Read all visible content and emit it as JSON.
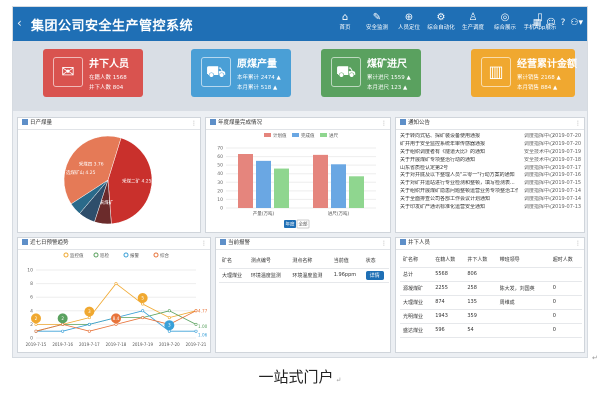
{
  "app": {
    "title": "集团公司安全生产管控系统",
    "back_icon": "chevron-left-icon"
  },
  "nav": [
    {
      "label": "首页",
      "icon": "home-icon",
      "glyph": "⌂"
    },
    {
      "label": "安全监测",
      "icon": "monitor-icon",
      "glyph": "✎"
    },
    {
      "label": "人员定位",
      "icon": "location-icon",
      "glyph": "⊕"
    },
    {
      "label": "综合自动化",
      "icon": "automation-icon",
      "glyph": "⚙"
    },
    {
      "label": "生产调度",
      "icon": "dispatch-icon",
      "glyph": "♙"
    },
    {
      "label": "综合展示",
      "icon": "display-icon",
      "glyph": "◎"
    },
    {
      "label": "手机App展示",
      "icon": "phone-icon",
      "glyph": "▯"
    }
  ],
  "topright": {
    "grid_glyph": "▦",
    "user_glyph": "☺",
    "help_glyph": "?",
    "account_glyph": "⚇▾"
  },
  "cards": [
    {
      "title": "井下人员",
      "line1": "在籍人数 1568",
      "line2": "井下人数 804",
      "color": "#d9534f",
      "glyph": "✉"
    },
    {
      "title": "原煤产量",
      "line1": "本年累计 2474 ▲",
      "line2": "本月累计 518 ▲",
      "color": "#4a9fd6",
      "glyph": "⛟"
    },
    {
      "title": "煤矿进尺",
      "line1": "累计进尺 1559 ▲",
      "line2": "本月进尺 123 ▲",
      "color": "#5aa15f",
      "glyph": "⛟"
    },
    {
      "title": "经营累计金额",
      "line1": "累计销售 2168 ▲",
      "line2": "本月销售 884 ▲",
      "color": "#f0a830",
      "glyph": "▥"
    }
  ],
  "panels": {
    "pie": {
      "title": "日产煤量"
    },
    "bar": {
      "title": "年度煤量完成情况"
    },
    "notice": {
      "title": "通知公告"
    },
    "line": {
      "title": "近七日预警趋势"
    },
    "alarm": {
      "title": "当前报警"
    },
    "people": {
      "title": "井下人员"
    }
  },
  "pie_chart": {
    "slices": [
      {
        "label": "采煤二矿 4.25",
        "value": 4.25,
        "color": "#c9302c"
      },
      {
        "label": "综采煤矿",
        "value": 0.6,
        "color": "#6b2b2b"
      },
      {
        "label": "",
        "value": 0.6,
        "color": "#2e4e6b"
      },
      {
        "label": "",
        "value": 0.45,
        "color": "#2a6a8a"
      },
      {
        "label": "采煤四 3.76",
        "value": 3.76,
        "color": "#e57a57"
      }
    ],
    "left_label": "选煤矿山 4.25"
  },
  "bar_chart": {
    "legend": [
      "计划值",
      "完成值",
      "进尺"
    ],
    "colors": [
      "#e5857d",
      "#6aa7e3",
      "#8fd68f"
    ],
    "categories": [
      "产量(万吨)",
      "进尺(万吨)"
    ],
    "series": [
      [
        63,
        62
      ],
      [
        55,
        51
      ],
      [
        46,
        37
      ]
    ],
    "yticks": [
      "70",
      "60",
      "50",
      "40",
      "30",
      "20",
      "10",
      "0"
    ],
    "ymax": 70,
    "btn_year": "年度",
    "btn_all": "全部"
  },
  "notices": [
    {
      "t": "关于转向式钻、探矿装设备使用通报",
      "s": "调度指挥中心",
      "d": "2019-07-20"
    },
    {
      "t": "矿井用于安全监控系统年审传感器通报",
      "s": "调度指挥中心",
      "d": "2019-07-20"
    },
    {
      "t": "关于组织调度者有《隧道大比》的通知",
      "s": "安全技术中心",
      "d": "2019-07-19"
    },
    {
      "t": "关于开展煤矿专项整治行动的通知",
      "s": "安全技术中心",
      "d": "2019-07-18"
    },
    {
      "t": "山东省质检认定第2号",
      "s": "调度指挥中心",
      "d": "2019-07-17"
    },
    {
      "t": "关于对井底及以下整理人员\"三零一\"行动方案的通知",
      "s": "调度指挥中心",
      "d": "2019-07-16"
    },
    {
      "t": "关于对矿井运站进行专业检测和整顿，填写检测表...",
      "s": "调度指挥中心",
      "d": "2019-07-15"
    },
    {
      "t": "关于组织开展煤矿隐患问题整顿运营业务专项整治工作（8...",
      "s": "调度指挥中心",
      "d": "2019-07-14"
    },
    {
      "t": "关于全面排查公司各部工作会议计划通知",
      "s": "调度指挥中心",
      "d": "2019-07-14"
    },
    {
      "t": "关于印发矿产通讯标准化运营安全通知",
      "s": "调度指挥中心",
      "d": "2019-07-13"
    }
  ],
  "line_chart": {
    "legend": [
      "监控值",
      "巡检",
      "报警",
      "综合"
    ],
    "colors": [
      "#f0a830",
      "#5aa15f",
      "#3aa0d8",
      "#e8743b"
    ],
    "x": [
      "2019-7-15",
      "2019-7-16",
      "2019-7-17",
      "2019-7-18",
      "2019-7-19",
      "2019-7-20",
      "2019-7-21"
    ],
    "yticks": [
      "10",
      "8",
      "6",
      "4",
      "2",
      "0"
    ],
    "ymax": 10,
    "series": [
      {
        "values": [
          2,
          2,
          3,
          8,
          5,
          3,
          4
        ]
      },
      {
        "values": [
          1,
          2,
          2,
          3,
          3,
          4,
          2
        ]
      },
      {
        "values": [
          1,
          1,
          2,
          3,
          4,
          1,
          1
        ]
      },
      {
        "values": [
          1,
          2,
          1,
          2,
          3,
          2,
          4
        ]
      }
    ],
    "badges": [
      {
        "label": "2",
        "i": 0,
        "s": 0
      },
      {
        "label": "2",
        "i": 1,
        "s": 1
      },
      {
        "label": "3",
        "i": 2,
        "s": 0
      },
      {
        "label": "8.4",
        "i": 3,
        "s": 3
      },
      {
        "label": "5",
        "i": 4,
        "s": 0
      },
      {
        "label": "3",
        "i": 5,
        "s": 2
      }
    ],
    "end_labels": [
      "4.77",
      "1.00",
      "1.06"
    ]
  },
  "alarm_table": {
    "headers": [
      "矿名",
      "测点编号",
      "测点名称",
      "当前值",
      "状态"
    ],
    "rows": [
      [
        "大理煤业",
        "环境温度监测",
        "环境温度监测",
        "1.96ppm",
        "详情"
      ]
    ]
  },
  "people_table": {
    "headers": [
      "矿名称",
      "在籍人数",
      "井下人数",
      "带班领导",
      "超时人数"
    ],
    "rows": [
      [
        "总计",
        "5568",
        "806",
        "",
        ""
      ],
      [
        "源凝煤矿",
        "2255",
        "258",
        "陈大发，刘国英",
        "0"
      ],
      [
        "大理煤业",
        "874",
        "135",
        "周维成",
        "0"
      ],
      [
        "光明煤业",
        "1943",
        "359",
        "",
        "0"
      ],
      [
        "盛达煤业",
        "596",
        "54",
        "",
        "0"
      ]
    ]
  },
  "caption": "一站式门户"
}
